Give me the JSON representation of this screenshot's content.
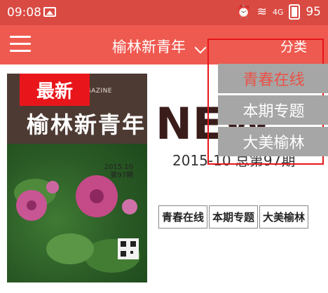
{
  "status_bar": {
    "time": "09:08",
    "battery": "95",
    "signal_text": "4G"
  },
  "app_bar": {
    "title": "榆林新青年",
    "category_label": "分类"
  },
  "cover": {
    "badge": "最新",
    "magazine_label": "MAGAZINE",
    "title": "榆林新青年",
    "date": "2015.10",
    "issue": "第97期"
  },
  "headline": {
    "big_text": "NEW",
    "issue_line": "2015-10 总第97期"
  },
  "section_tabs": [
    "青春在线",
    "本期专题",
    "大美榆林"
  ],
  "dropdown": {
    "items": [
      {
        "label": "青春在线",
        "active": true
      },
      {
        "label": "本期专题",
        "active": false
      },
      {
        "label": "大美榆林",
        "active": false
      }
    ]
  },
  "colors": {
    "status_bar": "#d94a43",
    "app_bar": "#ef5a50",
    "badge": "#e8161b",
    "highlight_border": "#e8161b",
    "dropdown_bg": "#a6a6a6",
    "active_text": "#ea5146"
  },
  "icons": [
    "image-icon",
    "alarm-icon",
    "wifi-icon",
    "signal-icon",
    "battery-icon",
    "menu-icon",
    "chevron-down-icon"
  ]
}
